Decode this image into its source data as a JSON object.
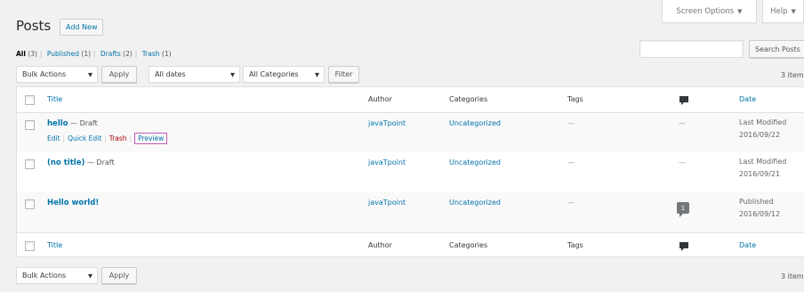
{
  "header": {
    "screen_options": "Screen Options",
    "help": "Help",
    "title": "Posts",
    "add_new": "Add New"
  },
  "views": {
    "all": "All",
    "all_count": "(3)",
    "published": "Published",
    "published_count": "(1)",
    "drafts": "Drafts",
    "drafts_count": "(2)",
    "trash": "Trash",
    "trash_count": "(1)",
    "separator": "|"
  },
  "search": {
    "button": "Search Posts"
  },
  "top_nav": {
    "bulk_actions": "Bulk Actions",
    "apply": "Apply",
    "dates": "All dates",
    "categories": "All Categories",
    "filter": "Filter",
    "items": "3 item"
  },
  "bottom_nav": {
    "bulk_actions": "Bulk Actions",
    "apply": "Apply",
    "items": "3 item"
  },
  "columns": {
    "title": "Title",
    "author": "Author",
    "categories": "Categories",
    "tags": "Tags",
    "date": "Date"
  },
  "rows": [
    {
      "title": "hello",
      "state": " — Draft",
      "author": "javaTpoint",
      "category": "Uncategorized",
      "tags": "—",
      "comments": "—",
      "date_status": "Last Modified",
      "date": "2016/09/22",
      "actions": {
        "edit": "Edit",
        "quick_edit": "Quick Edit",
        "trash": "Trash",
        "preview": "Preview",
        "sep": "|"
      }
    },
    {
      "title": "(no title)",
      "state": " — Draft",
      "author": "javaTpoint",
      "category": "Uncategorized",
      "tags": "—",
      "comments": "—",
      "date_status": "Last Modified",
      "date": "2016/09/21"
    },
    {
      "title": "Hello world!",
      "state": "",
      "author": "javaTpoint",
      "category": "Uncategorized",
      "tags": "—",
      "comments": "1",
      "date_status": "Published",
      "date": "2016/09/12"
    }
  ],
  "icons": {
    "caret": "caret-down-icon",
    "comments": "comment-bubble-icon",
    "select_arrow": "triangle-down-icon"
  },
  "colors": {
    "link": "#0073aa",
    "trash": "#a00000",
    "highlight_border": "#c35bb7",
    "background": "#f1f1f1"
  }
}
